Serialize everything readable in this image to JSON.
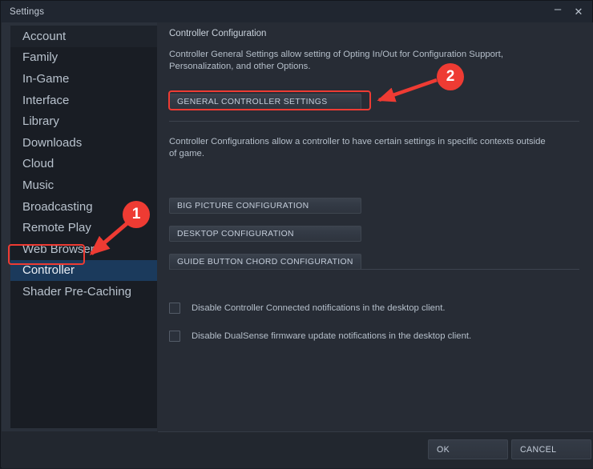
{
  "window": {
    "title": "Settings",
    "minimize_icon": "minimize-icon",
    "minimize_glyph": "–",
    "close_icon": "close-icon",
    "close_glyph": "✕"
  },
  "sidebar": {
    "items": [
      {
        "label": "Account",
        "selected": false
      },
      {
        "label": "Family",
        "selected": false
      },
      {
        "label": "In-Game",
        "selected": false
      },
      {
        "label": "Interface",
        "selected": false
      },
      {
        "label": "Library",
        "selected": false
      },
      {
        "label": "Downloads",
        "selected": false
      },
      {
        "label": "Cloud",
        "selected": false
      },
      {
        "label": "Music",
        "selected": false
      },
      {
        "label": "Broadcasting",
        "selected": false
      },
      {
        "label": "Remote Play",
        "selected": false
      },
      {
        "label": "Web Browser",
        "selected": false
      },
      {
        "label": "Controller",
        "selected": true
      },
      {
        "label": "Shader Pre-Caching",
        "selected": false
      }
    ]
  },
  "main": {
    "section_title": "Controller Configuration",
    "description_1": "Controller General Settings allow setting of Opting In/Out for Configuration Support, Personalization, and other Options.",
    "general_settings_button": "GENERAL CONTROLLER SETTINGS",
    "description_2": "Controller Configurations allow a controller to have certain settings in specific contexts outside of game.",
    "big_picture_button": "BIG PICTURE CONFIGURATION",
    "desktop_button": "DESKTOP CONFIGURATION",
    "guide_button": "GUIDE BUTTON CHORD CONFIGURATION",
    "checkboxes": [
      {
        "label": "Disable Controller Connected notifications in the desktop client.",
        "checked": false
      },
      {
        "label": "Disable DualSense firmware update notifications in the desktop client.",
        "checked": false
      }
    ]
  },
  "footer": {
    "ok_label": "OK",
    "cancel_label": "CANCEL"
  },
  "annotations": {
    "accent_color": "#ee3b33",
    "badges": [
      {
        "number": "1",
        "points_to": "sidebar-item-controller"
      },
      {
        "number": "2",
        "points_to": "general-controller-settings-button"
      }
    ]
  },
  "colors": {
    "window_bg": "#22272f",
    "titlebar_bg": "#202630",
    "sidebar_panel_bg": "#2a303a",
    "sidebar_list_bg": "#191d24",
    "sidebar_selected_bg": "#1b3a5c",
    "main_bg": "#272c35",
    "text_primary": "#c9d2dc",
    "text_secondary": "#b5bfca",
    "annotation_red": "#ee3b33"
  }
}
